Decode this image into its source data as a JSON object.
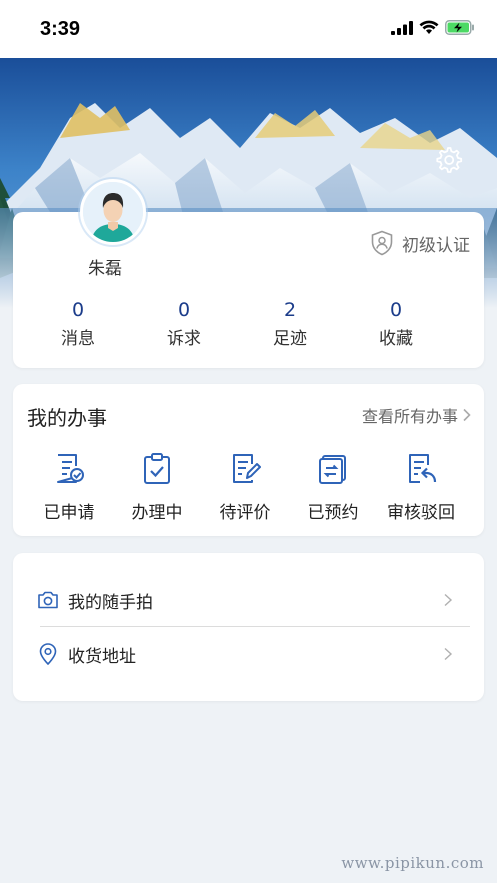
{
  "status_bar": {
    "time": "3:39"
  },
  "profile": {
    "username": "朱磊",
    "verification": "初级认证",
    "stats": [
      {
        "value": "0",
        "label": "消息"
      },
      {
        "value": "0",
        "label": "诉求"
      },
      {
        "value": "2",
        "label": "足迹"
      },
      {
        "value": "0",
        "label": "收藏"
      }
    ]
  },
  "tasks": {
    "title": "我的办事",
    "more": "查看所有办事",
    "items": [
      {
        "label": "已申请",
        "icon": "applied-icon"
      },
      {
        "label": "办理中",
        "icon": "processing-icon"
      },
      {
        "label": "待评价",
        "icon": "to-review-icon"
      },
      {
        "label": "已预约",
        "icon": "appointment-icon"
      },
      {
        "label": "审核驳回",
        "icon": "rejected-icon"
      }
    ]
  },
  "menu": [
    {
      "label": "我的随手拍",
      "icon": "camera-icon"
    },
    {
      "label": "收货地址",
      "icon": "location-pin-icon"
    }
  ],
  "watermark": "www.pipikun.com",
  "colors": {
    "accent": "#2f64b8",
    "stat_value": "#1b3c8a",
    "background": "#eef2f6"
  }
}
